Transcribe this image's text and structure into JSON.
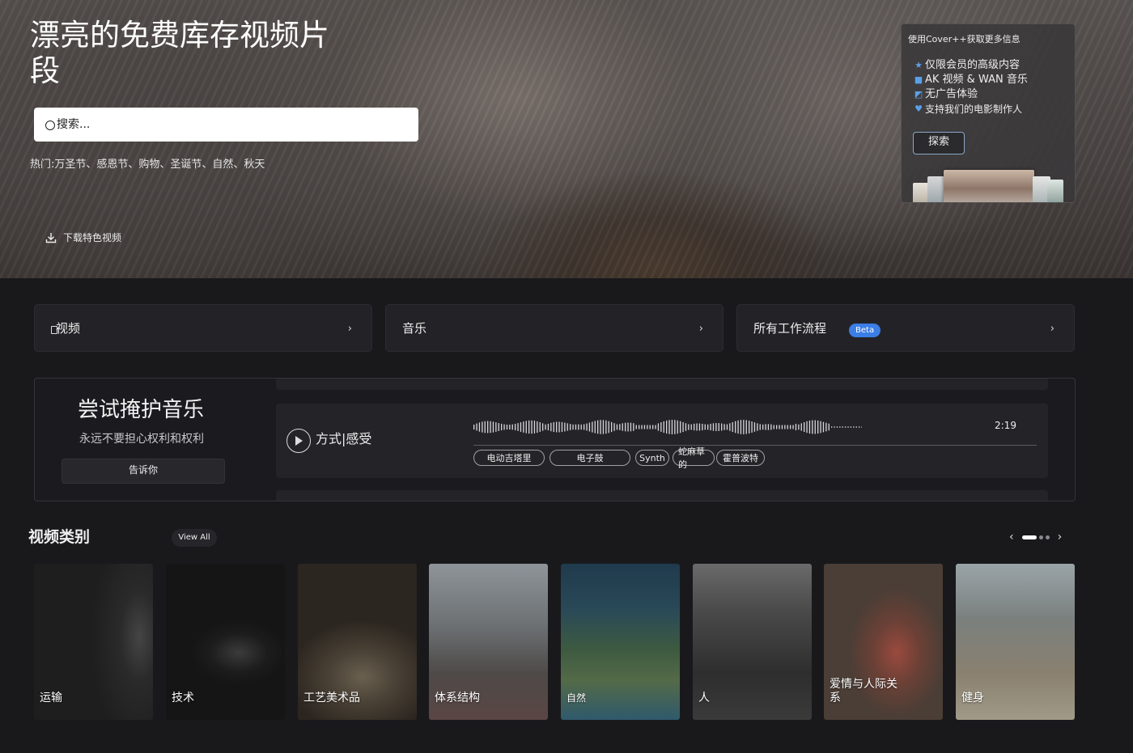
{
  "hero": {
    "title": "漂亮的免费库存视频片段",
    "search_placeholder": "搜索...",
    "popular": "热门:万圣节、感恩节、购物、圣诞节、自然、秋天",
    "download_label": "下载特色视频"
  },
  "promo": {
    "title": "使用Cover++获取更多信息",
    "items": [
      {
        "icon": "star-icon",
        "label": "仅限会员的高级内容"
      },
      {
        "icon": "music-icon",
        "label": "AK 视频 & WAN 音乐"
      },
      {
        "icon": "no-ads-icon",
        "label": "无广告体验"
      },
      {
        "icon": "heart-icon",
        "label": "支持我们的电影制作人"
      }
    ],
    "explore_label": "探索"
  },
  "nav_cards": [
    {
      "label": "视频",
      "icon": "video-icon"
    },
    {
      "label": "音乐"
    },
    {
      "label": "所有工作流程",
      "badge": "Beta"
    }
  ],
  "music": {
    "title": "尝试掩护音乐",
    "subtitle": "永远不要担心权利和权利",
    "button_label": "告诉你",
    "track": {
      "name": "方式|感受",
      "duration": "2:19",
      "tags": [
        "电动吉塔里",
        "电子鼓",
        "Synth",
        "蛇麻草的",
        "霍普波特"
      ]
    }
  },
  "categories": {
    "title": "视频类别",
    "view_all": "View All",
    "items": [
      "运输",
      "技术",
      "工艺美术品",
      "体系结构",
      "自然",
      "人",
      "爱情与人际关系",
      "健身"
    ]
  },
  "colors": {
    "page_bg": "#19191c",
    "card_bg": "#232327",
    "accent": "#3b7ee6"
  }
}
